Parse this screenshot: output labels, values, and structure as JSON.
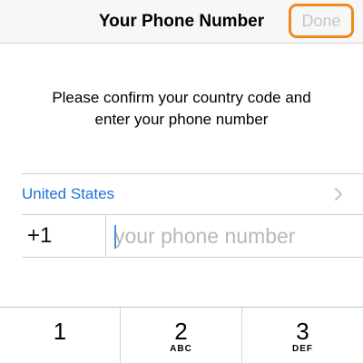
{
  "navbar": {
    "title": "Your Phone Number",
    "done_label": "Done"
  },
  "instructions": {
    "line1": "Please confirm your country code and",
    "line2": "enter your phone number"
  },
  "country": {
    "name": "United States",
    "chevron_icon": "chevron-right-icon"
  },
  "phone": {
    "country_code": "+1",
    "value": "",
    "placeholder": "your phone number"
  },
  "keypad": {
    "keys": [
      {
        "digit": "1",
        "letters": ""
      },
      {
        "digit": "2",
        "letters": "ABC"
      },
      {
        "digit": "3",
        "letters": "DEF"
      }
    ]
  },
  "colors": {
    "accent": "#1a73d9",
    "highlight": "#f08a1c",
    "disabled": "#c6c6c8"
  }
}
